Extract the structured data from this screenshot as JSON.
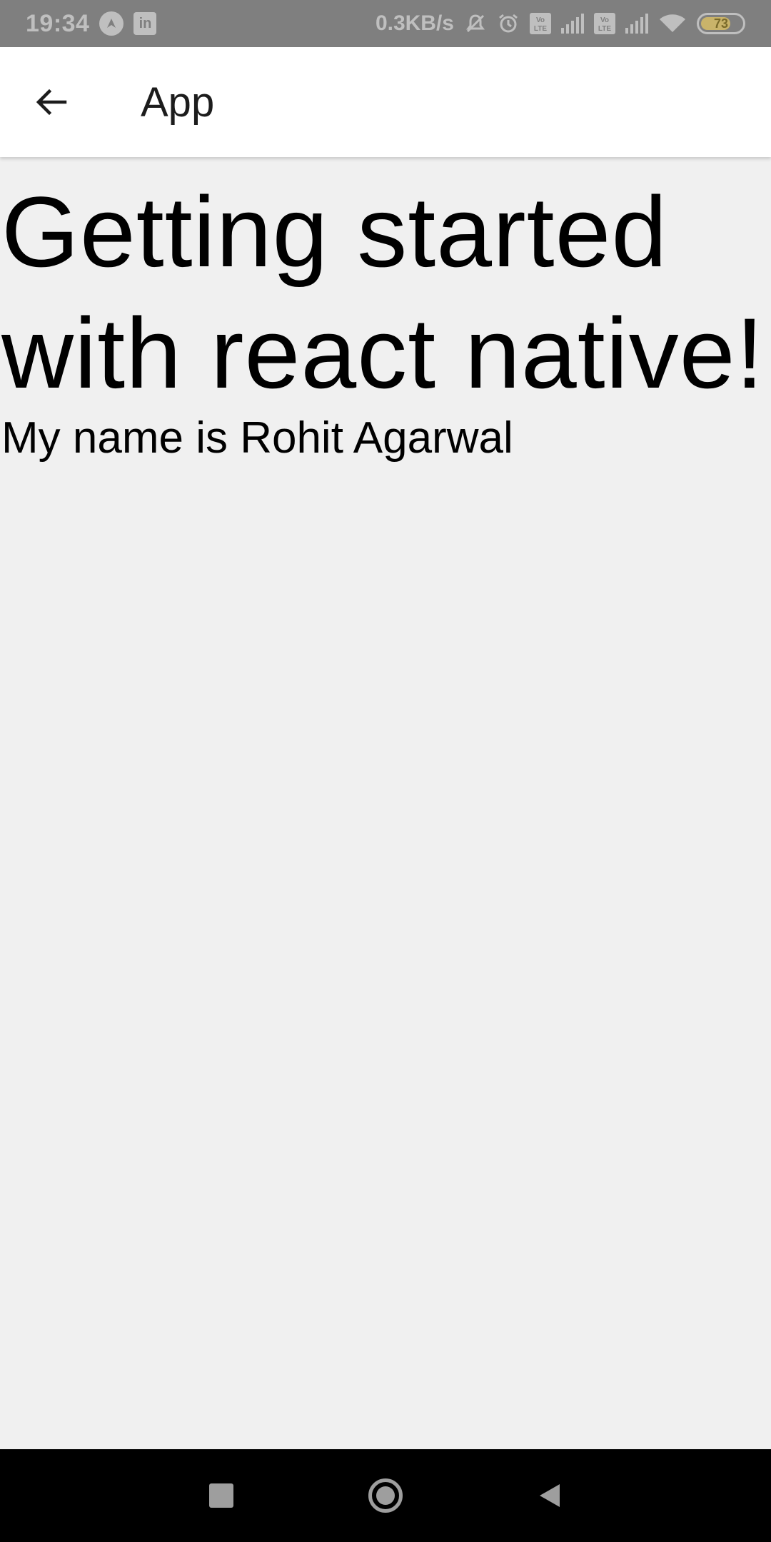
{
  "status_bar": {
    "time": "19:34",
    "notif_icon_1": "navigation-icon",
    "notif_icon_2_label": "in",
    "network_speed": "0.3KB/s",
    "icons": [
      "mute-icon",
      "alarm-icon",
      "volte-icon",
      "signal-icon",
      "volte-icon",
      "signal-icon",
      "wifi-icon"
    ],
    "volte_label": "Vo LTE",
    "battery_level": 73,
    "battery_text": "73"
  },
  "app_bar": {
    "back_icon": "arrow-left-icon",
    "title": "App"
  },
  "main": {
    "heading": "Getting started with react native!",
    "subtext": "My name is Rohit Agarwal"
  },
  "nav_bar": {
    "buttons": [
      "recents-icon",
      "home-icon",
      "back-icon"
    ]
  },
  "colors": {
    "status_bar_bg": "#7f7f7f",
    "app_bar_bg": "#ffffff",
    "content_bg": "#f0f0f0",
    "nav_bar_bg": "#000000"
  }
}
